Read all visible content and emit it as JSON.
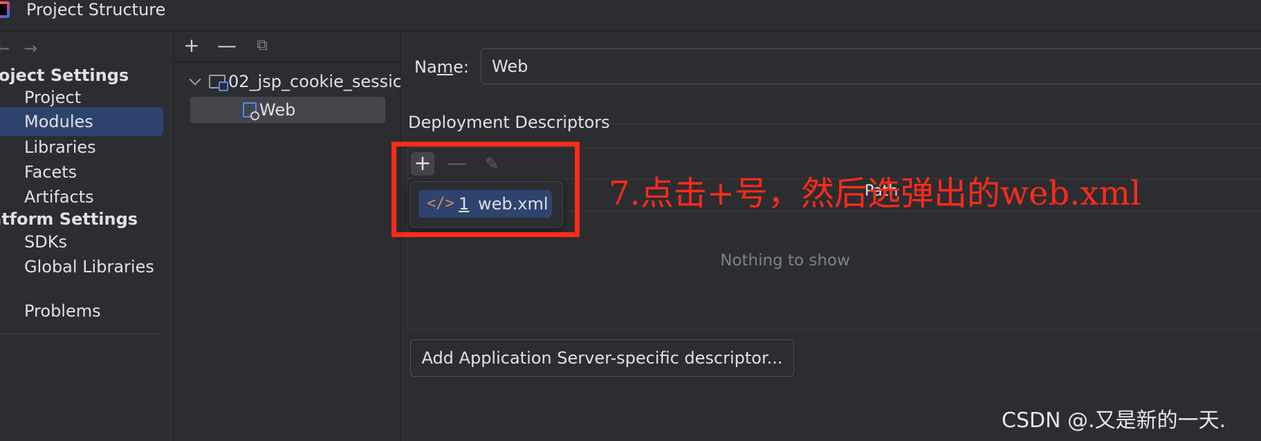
{
  "window": {
    "title": "Project Structure"
  },
  "nav": {
    "back_arrow": "←",
    "forward_arrow": "→",
    "project_settings_label": "roject Settings",
    "platform_settings_label": "atform Settings",
    "project_items": [
      "Project",
      "Modules",
      "Libraries",
      "Facets",
      "Artifacts"
    ],
    "platform_items": [
      "SDKs",
      "Global Libraries"
    ],
    "problems_label": "Problems",
    "selected_item": "Modules"
  },
  "tree": {
    "toolbar": {
      "add": "+",
      "remove": "—",
      "copy": "⧉"
    },
    "root_label": "02_jsp_cookie_sessic",
    "child_label": "Web"
  },
  "main": {
    "name_label_pre": "Na",
    "name_label_mnemonic": "m",
    "name_label_post": "e:",
    "name_value": "Web",
    "section_title": "Deployment Descriptors",
    "toolbar": {
      "add": "+",
      "remove": "—",
      "edit": "✎"
    },
    "column_path": "Path",
    "empty_text": "Nothing to show",
    "add_server_button": "Add Application Server-specific descriptor..."
  },
  "popup": {
    "icon": "</>",
    "number": "1",
    "label": "web.xml"
  },
  "annotation": {
    "text": "7.点击+号，然后选弹出的web.xml",
    "color": "#ff2a1a"
  },
  "watermark": "CSDN @.又是新的一天.",
  "colors": {
    "background": "#2b2d30",
    "selection": "#2e436e",
    "text": "#dfe1e5",
    "muted": "#7e8188"
  }
}
